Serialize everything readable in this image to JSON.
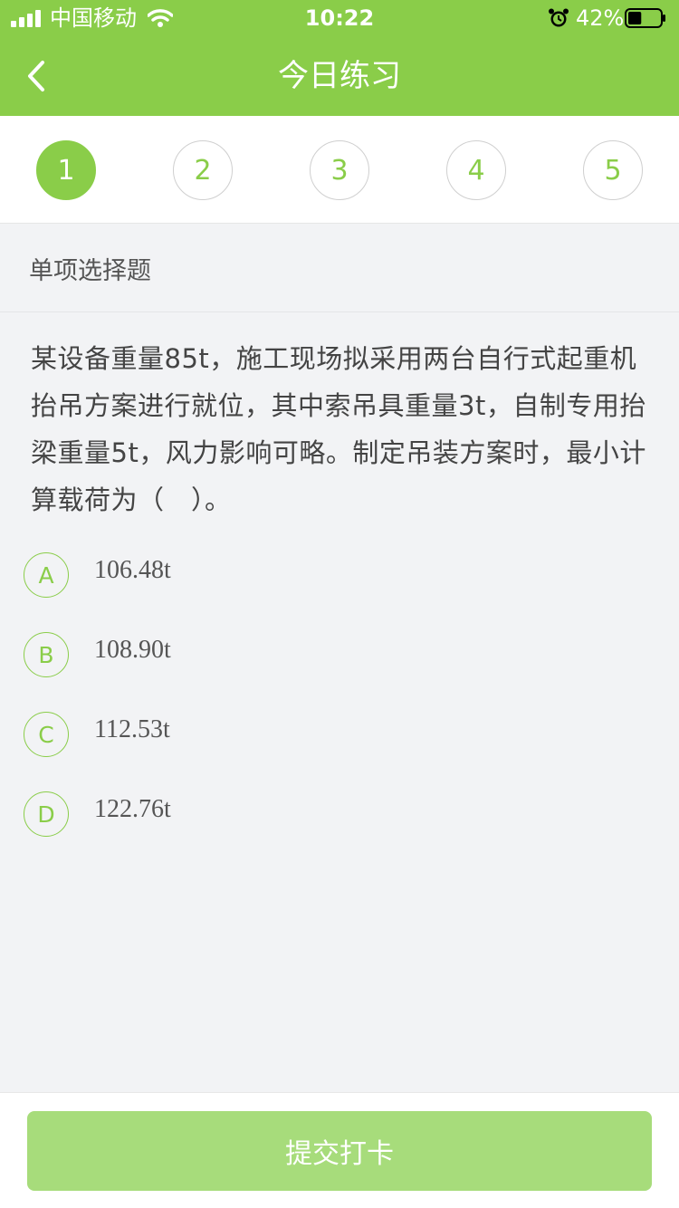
{
  "status_bar": {
    "carrier": "中国移动",
    "time": "10:22",
    "battery_percent": "42%",
    "battery_level": 0.42
  },
  "nav": {
    "title": "今日练习",
    "back_icon": "chevron-left-icon"
  },
  "question_numbers": [
    "1",
    "2",
    "3",
    "4",
    "5"
  ],
  "active_question": "1",
  "section": {
    "title": "单项选择题"
  },
  "question": {
    "text": "某设备重量85t，施工现场拟采用两台自行式起重机抬吊方案进行就位，其中索吊具重量3t，自制专用抬梁重量5t，风力影响可略。制定吊装方案时，最小计算载荷为（　）。"
  },
  "options": [
    {
      "letter": "A",
      "text": "106.48t"
    },
    {
      "letter": "B",
      "text": "108.90t"
    },
    {
      "letter": "C",
      "text": "112.53t"
    },
    {
      "letter": "D",
      "text": "122.76t"
    }
  ],
  "footer": {
    "submit_label": "提交打卡"
  },
  "colors": {
    "accent": "#8acd49",
    "submit_bg": "#a7dc7b",
    "page_bg": "#f2f3f5"
  }
}
